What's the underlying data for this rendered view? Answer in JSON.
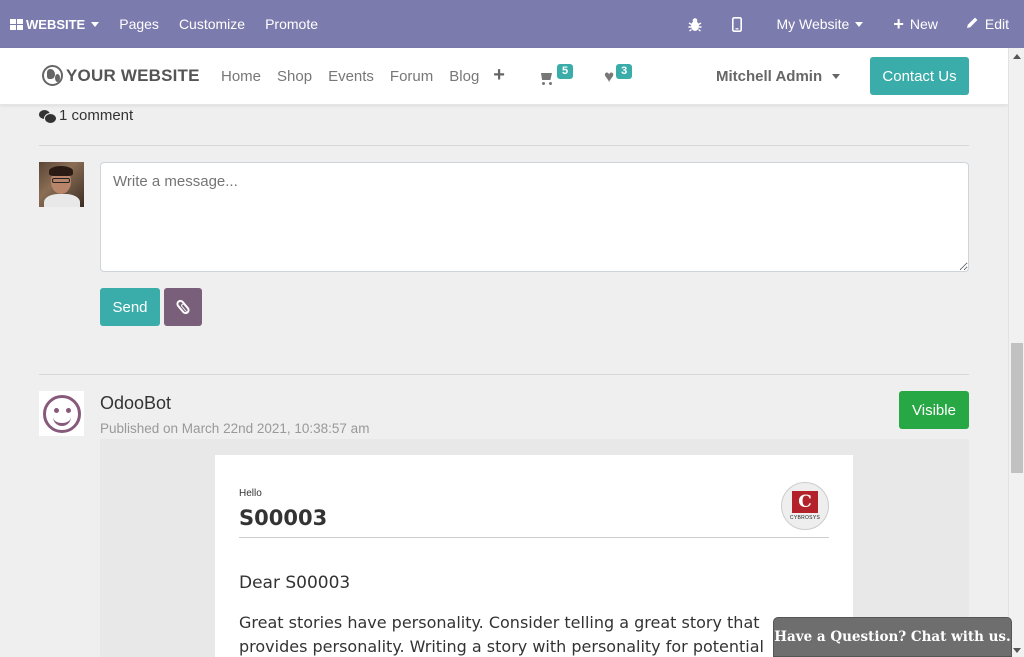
{
  "admin_bar": {
    "brand": "WEBSITE",
    "items": [
      "Pages",
      "Customize",
      "Promote"
    ],
    "my_website": "My Website",
    "new": "New",
    "edit": "Edit"
  },
  "navbar": {
    "logo": "YOUR WEBSITE",
    "menu": [
      "Home",
      "Shop",
      "Events",
      "Forum",
      "Blog"
    ],
    "cart_count": "5",
    "wishlist_count": "3",
    "user": "Mitchell Admin",
    "contact": "Contact Us"
  },
  "comments": {
    "count_text": "1 comment",
    "placeholder": "Write a message...",
    "send": "Send"
  },
  "message": {
    "author": "OdooBot",
    "published": "Published on March 22nd 2021, 10:38:57 am",
    "visibility": "Visible",
    "card": {
      "hello": "Hello",
      "code": "S00003",
      "logo_letter": "C",
      "logo_text": "CYBROSYS",
      "dear": "Dear S00003",
      "paragraph": "Great stories have personality. Consider telling a great story that provides personality. Writing a story with personality for potential"
    }
  },
  "chat": {
    "label": "Have a Question? Chat with us."
  }
}
